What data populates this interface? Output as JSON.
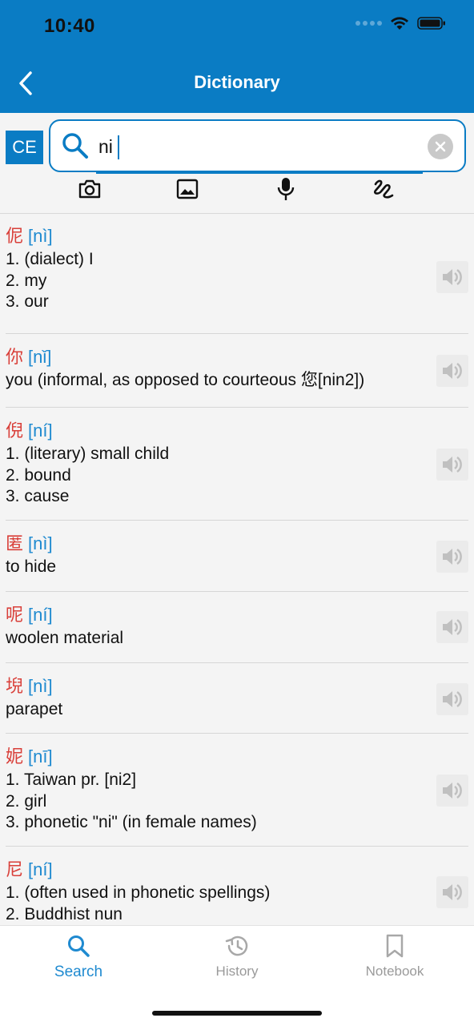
{
  "status": {
    "time": "10:40"
  },
  "nav": {
    "title": "Dictionary"
  },
  "search": {
    "mode": "CE",
    "value": "ni"
  },
  "tools": [
    "camera-icon",
    "image-icon",
    "microphone-icon",
    "handwriting-icon"
  ],
  "entries": [
    {
      "hanzi": "伲",
      "pinyin": "[nì]",
      "defs": [
        "1. (dialect) I",
        "2. my",
        "3. our"
      ]
    },
    {
      "hanzi": "你",
      "pinyin": "[nǐ]",
      "defs": [
        "you (informal, as opposed to courteous 您[nin2])"
      ]
    },
    {
      "hanzi": "倪",
      "pinyin": "[ní]",
      "defs": [
        "1. (literary) small child",
        "2. bound",
        "3. cause"
      ]
    },
    {
      "hanzi": "匿",
      "pinyin": "[nì]",
      "defs": [
        "to hide"
      ]
    },
    {
      "hanzi": "呢",
      "pinyin": "[ní]",
      "defs": [
        "woolen material"
      ]
    },
    {
      "hanzi": "堄",
      "pinyin": "[nì]",
      "defs": [
        "parapet"
      ]
    },
    {
      "hanzi": "妮",
      "pinyin": "[nī]",
      "defs": [
        "1. Taiwan pr. [ni2]",
        "2. girl",
        "3. phonetic \"ni\" (in female names)"
      ]
    },
    {
      "hanzi": "尼",
      "pinyin": "[ní]",
      "defs": [
        "1. (often used in phonetic spellings)",
        "2. Buddhist nun"
      ]
    }
  ],
  "tabs": [
    {
      "label": "Search",
      "icon": "search-icon",
      "active": true
    },
    {
      "label": "History",
      "icon": "history-icon",
      "active": false
    },
    {
      "label": "Notebook",
      "icon": "bookmark-icon",
      "active": false
    }
  ],
  "colors": {
    "brand": "#0a7cc4",
    "hanzi": "#d9403a",
    "pinyin": "#1f8ad0"
  }
}
